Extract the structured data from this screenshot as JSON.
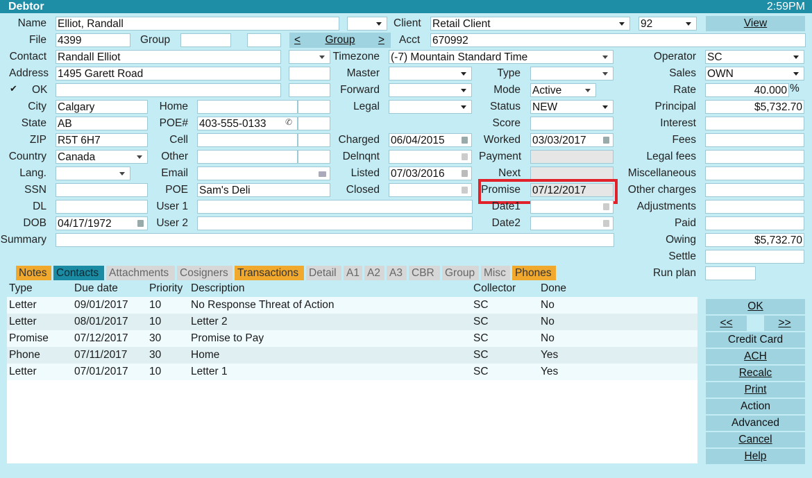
{
  "window": {
    "title": "Debtor",
    "clock": "2:59PM"
  },
  "labels": {
    "name": "Name",
    "client": "Client",
    "file": "File",
    "group": "Group",
    "acct": "Acct",
    "contact": "Contact",
    "timezone": "Timezone",
    "operator": "Operator",
    "address": "Address",
    "master": "Master",
    "type": "Type",
    "sales": "Sales",
    "ok": "OK",
    "forward": "Forward",
    "mode": "Mode",
    "rate": "Rate",
    "city": "City",
    "home": "Home",
    "legal": "Legal",
    "status": "Status",
    "principal": "Principal",
    "state": "State",
    "poe_num": "POE#",
    "score": "Score",
    "interest": "Interest",
    "zip": "ZIP",
    "cell": "Cell",
    "charged": "Charged",
    "worked": "Worked",
    "fees": "Fees",
    "country": "Country",
    "other": "Other",
    "delnqnt": "Delnqnt",
    "payment": "Payment",
    "legal_fees": "Legal fees",
    "lang": "Lang.",
    "email": "Email",
    "listed": "Listed",
    "next": "Next",
    "misc": "Miscellaneous",
    "ssn": "SSN",
    "poe": "POE",
    "closed": "Closed",
    "promise": "Promise",
    "other_charges": "Other charges",
    "dl": "DL",
    "user1": "User 1",
    "date1": "Date1",
    "adjustments": "Adjustments",
    "dob": "DOB",
    "user2": "User 2",
    "date2": "Date2",
    "paid": "Paid",
    "summary": "Summary",
    "owing": "Owing",
    "settle": "Settle",
    "run_plan": "Run plan"
  },
  "values": {
    "name": "Elliot, Randall",
    "client": "Retail Client",
    "client_num": "92",
    "file": "4399",
    "acct": "670992",
    "contact": "Randall Elliot",
    "timezone": "(-7) Mountain Standard Time",
    "operator": "SC",
    "address": "1495 Garett Road",
    "sales": "OWN",
    "mode": "Active",
    "rate": "40.000",
    "rate_unit": "%",
    "city": "Calgary",
    "status": "NEW",
    "principal": "$5,732.70",
    "state": "AB",
    "poe_num": "403-555-0133",
    "zip": "R5T 6H7",
    "charged": "06/04/2015",
    "worked": "03/03/2017",
    "country": "Canada",
    "listed": "07/03/2016",
    "poe": "Sam's Deli",
    "promise": "07/12/2017",
    "dob": "04/17/1972",
    "owing": "$5,732.70"
  },
  "buttons": {
    "view": "View",
    "group_prev": "<",
    "group": "Group",
    "group_next": ">",
    "ok": "OK",
    "prev": "<<",
    "next": ">>",
    "credit_card": "Credit Card",
    "ach": "ACH",
    "recalc": "Recalc",
    "print": "Print",
    "action": "Action",
    "advanced": "Advanced",
    "cancel": "Cancel",
    "help": "Help"
  },
  "tabs": [
    "Notes",
    "Contacts",
    "Attachments",
    "Cosigners",
    "Transactions",
    "Detail",
    "A1",
    "A2",
    "A3",
    "CBR",
    "Group",
    "Misc",
    "Phones"
  ],
  "grid": {
    "headers": [
      "Type",
      "Due date",
      "Priority",
      "Description",
      "Collector",
      "Done"
    ],
    "rows": [
      [
        "Letter",
        "09/01/2017",
        "10",
        "No Response Threat of Action",
        "SC",
        "No"
      ],
      [
        "Letter",
        "08/01/2017",
        "10",
        "Letter 2",
        "SC",
        "No"
      ],
      [
        "Promise",
        "07/12/2017",
        "30",
        "Promise to Pay",
        "SC",
        "No"
      ],
      [
        "Phone",
        "07/11/2017",
        "30",
        "Home",
        "SC",
        "Yes"
      ],
      [
        "Letter",
        "07/01/2017",
        "10",
        "Letter 1",
        "SC",
        "Yes"
      ]
    ]
  },
  "colors": {
    "titlebar": "#1d8ea6",
    "background": "#c4ecf4",
    "tab_orange": "#f0a92c",
    "tab_active": "#1b8aa3",
    "highlight": "#e2222a"
  }
}
